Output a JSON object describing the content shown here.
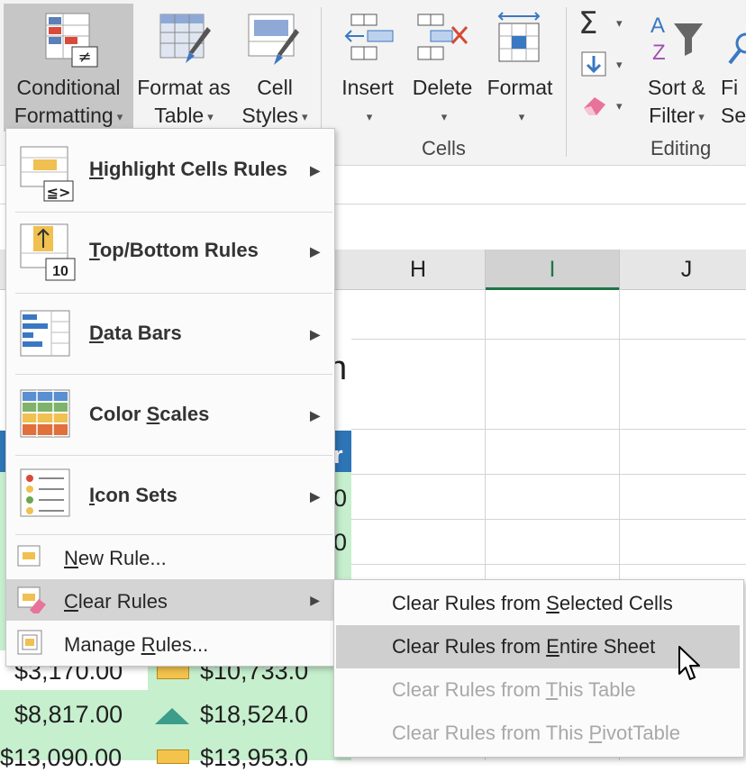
{
  "ribbon": {
    "conditional_formatting": {
      "line1": "Conditional",
      "line2": "Formatting"
    },
    "format_as_table": {
      "line1": "Format as",
      "line2": "Table"
    },
    "cell_styles": {
      "line1": "Cell",
      "line2": "Styles"
    },
    "insert": "Insert",
    "delete": "Delete",
    "format": "Format",
    "cells_group": "Cells",
    "sort_filter": {
      "line1": "Sort &",
      "line2": "Filter"
    },
    "find_select": {
      "line1": "Fi",
      "line2": "Sel"
    },
    "editing_group": "Editing"
  },
  "columns": [
    "H",
    "I",
    "J"
  ],
  "cells": {
    "row1_a": "$3,170.00",
    "row1_b": "$10,733.0",
    "row2_a": "$8,817.00",
    "row2_b": "$18,524.0",
    "row3_a": "$13,090.00",
    "row3_b": "$13,953.0",
    "partial_zero_1": "0",
    "partial_zero_2": "0",
    "partial_r": "r",
    "partial_n": "n"
  },
  "menu": {
    "highlight_cells": {
      "pre": "",
      "ul": "H",
      "post": "ighlight Cells Rules"
    },
    "top_bottom": {
      "pre": "",
      "ul": "T",
      "post": "op/Bottom Rules"
    },
    "data_bars": {
      "pre": "",
      "ul": "D",
      "post": "ata Bars"
    },
    "color_scales": {
      "pre": "Color ",
      "ul": "S",
      "post": "cales"
    },
    "icon_sets": {
      "pre": "",
      "ul": "I",
      "post": "con Sets"
    },
    "new_rule": {
      "pre": "",
      "ul": "N",
      "post": "ew Rule..."
    },
    "clear_rules": {
      "pre": "",
      "ul": "C",
      "post": "lear Rules"
    },
    "manage_rules": {
      "pre": "Manage ",
      "ul": "R",
      "post": "ules..."
    },
    "icon_badge": "10"
  },
  "submenu": {
    "selected_cells": {
      "pre": "Clear Rules from ",
      "ul": "S",
      "post": "elected Cells"
    },
    "entire_sheet": {
      "pre": "Clear Rules from ",
      "ul": "E",
      "post": "ntire Sheet"
    },
    "this_table": {
      "pre": "Clear Rules from ",
      "ul": "T",
      "post": "his Table"
    },
    "this_pivot": {
      "pre": "Clear Rules from This ",
      "ul": "P",
      "post": "ivotTable"
    }
  },
  "colors": {
    "accent_green": "#217346",
    "highlight_fill": "#c6efce",
    "header_blue": "#2e75b6"
  }
}
